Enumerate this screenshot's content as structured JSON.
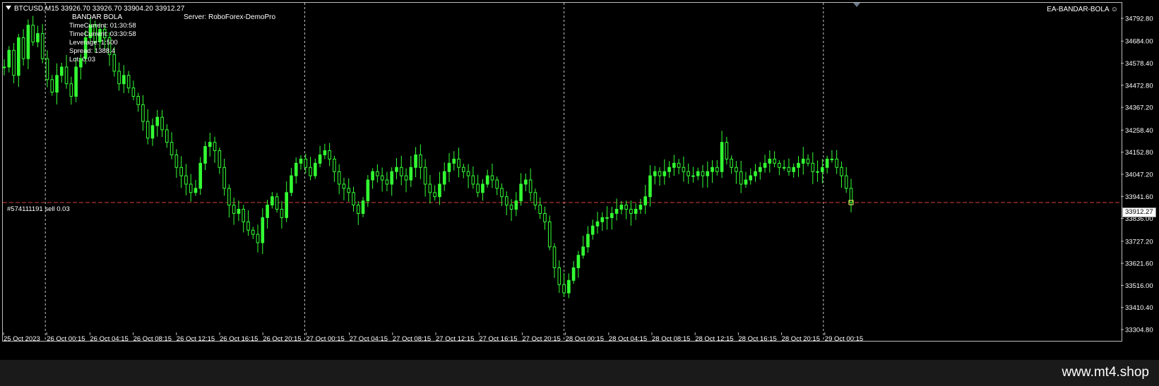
{
  "symbol_bar": {
    "text": "BTCUSD,M15  33926.70 33926.70 33904.20 33912.27"
  },
  "ea_panel": {
    "title": "BANDAR BOLA",
    "server": "Server:  RoboForex-DemoPro",
    "lines": [
      "TimeCurrent:  01:30:58",
      "TimeCurrent:  03:30:58",
      "Leverage:   1:500",
      "Spread:   1388.4",
      "Lot:      0.03"
    ]
  },
  "ea_name_right": "EA-BANDAR-BOLA ☺",
  "order_label": "#574111191 sell 0.03",
  "current_price": "33912.27",
  "watermark": "www.mt4.shop",
  "colors": {
    "background": "#000000",
    "candle": "#33ff33",
    "grid": "#c8c8c8",
    "order_line": "#d44040",
    "frame": "#bdbdbd"
  },
  "chart_data": {
    "type": "line",
    "series": [
      {
        "values": [
          34560,
          34640,
          34520,
          34700,
          34600,
          34760,
          34680,
          34720,
          34600,
          34500,
          34440,
          34520,
          34560,
          34480,
          34420,
          34560,
          34600,
          34700,
          34760,
          34680,
          34740,
          34700,
          34620,
          34540,
          34480,
          34520,
          34460,
          34420,
          34380,
          34300,
          34220,
          34280,
          34320,
          34260,
          34200,
          34140,
          34080,
          34040,
          34000,
          33960,
          33980,
          34100,
          34180,
          34200,
          34160,
          34080,
          33980,
          33900,
          33860,
          33880,
          33820,
          33780,
          33760,
          33720,
          33840,
          33900,
          33940,
          33880,
          33840,
          33960,
          34040,
          34100,
          34120,
          34080,
          34040,
          34100,
          34140,
          34160,
          34120,
          34060,
          34000,
          33980,
          33960,
          33900,
          33860,
          33920,
          34020,
          34060,
          34040,
          34020,
          34000,
          34060,
          34080,
          34040,
          34020,
          34080,
          34140,
          34080,
          34000,
          33960,
          33940,
          34000,
          34060,
          34100,
          34120,
          34080,
          34060,
          34040,
          34000,
          33960,
          34000,
          34040,
          34020,
          33980,
          33940,
          33900,
          33880,
          33920,
          34000,
          34020,
          33960,
          33900,
          33860,
          33820,
          33700,
          33600,
          33520,
          33480,
          33540,
          33600,
          33660,
          33700,
          33760,
          33800,
          33820,
          33840,
          33840,
          33860,
          33880,
          33900,
          33880,
          33860,
          33880,
          33900,
          33940,
          34040,
          34060,
          34040,
          34060,
          34080,
          34100,
          34080,
          34060,
          34040,
          34040,
          34060,
          34040,
          34060,
          34080,
          34060,
          34200,
          34120,
          34080,
          34060,
          34000,
          34020,
          34040,
          34060,
          34080,
          34100,
          34120,
          34100,
          34080,
          34080,
          34060,
          34080,
          34100,
          34120,
          34100,
          34060,
          34060,
          34080,
          34120,
          34120,
          34080,
          34040,
          33980,
          33912
        ],
        "color": "#33ff33"
      }
    ],
    "x_ticks": [
      "25 Oct 2023",
      "26 Oct 00:15",
      "26 Oct 04:15",
      "26 Oct 08:15",
      "26 Oct 12:15",
      "26 Oct 16:15",
      "26 Oct 20:15",
      "27 Oct 00:15",
      "27 Oct 04:15",
      "27 Oct 08:15",
      "27 Oct 12:15",
      "27 Oct 16:15",
      "27 Oct 20:15",
      "28 Oct 00:15",
      "28 Oct 04:15",
      "28 Oct 08:15",
      "28 Oct 12:15",
      "28 Oct 16:15",
      "28 Oct 20:15",
      "29 Oct 00:15"
    ],
    "y_ticks": [
      "34792.80",
      "34684.00",
      "34578.40",
      "34472.80",
      "34367.20",
      "34258.40",
      "34152.80",
      "34047.20",
      "33941.60",
      "33836.00",
      "33727.20",
      "33621.60",
      "33516.00",
      "33410.40",
      "33304.80"
    ],
    "ylim": [
      33304.8,
      34792.8
    ],
    "order_price": 33912.27,
    "vertical_separators_after_tick": [
      1,
      7,
      13,
      19
    ],
    "grid": false
  }
}
